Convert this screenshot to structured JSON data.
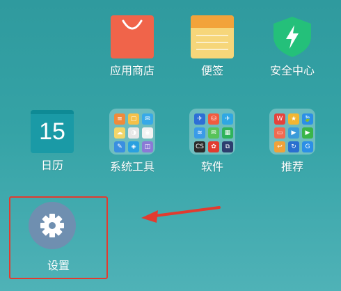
{
  "apps": {
    "app_store": {
      "label": "应用商店"
    },
    "notes": {
      "label": "便签"
    },
    "security": {
      "label": "安全中心"
    },
    "calendar": {
      "label": "日历",
      "day": "15"
    },
    "system_tools": {
      "label": "系统工具"
    },
    "software": {
      "label": "软件"
    },
    "recommend": {
      "label": "推荐"
    },
    "settings": {
      "label": "设置"
    }
  },
  "folder_icons": {
    "system_tools": [
      "#f08a3a",
      "#f4c14a",
      "#37a9e8",
      "#f2d66a",
      "#e6e6e6",
      "#f2f2f2",
      "#3a8fe0",
      "#2aa0e0",
      "#8a7ad6"
    ],
    "software": [
      "#2d6fd6",
      "#f15b3f",
      "#2fa7e3",
      "#3a9be8",
      "#58c35a",
      "#2fb35b",
      "#2b2b2b",
      "#e23b2f",
      "#2c3e6e"
    ],
    "recommend": [
      "#e5423b",
      "#f2b631",
      "#2c8fe6",
      "#f26a50",
      "#3a9ad9",
      "#3ab54a",
      "#f0a23a",
      "#2a6fd0",
      "#2c8fe6"
    ]
  },
  "folder_glyphs": {
    "system_tools": [
      "≡",
      "▢",
      "✉",
      "☁",
      "◑",
      "◉",
      "✎",
      "◈",
      "◫"
    ],
    "software": [
      "✈",
      "⛁",
      "✈",
      "≋",
      "✉",
      "▦",
      "CS",
      "✿",
      "⧉"
    ],
    "recommend": [
      "W",
      "★",
      "🍃",
      "▭",
      "▶",
      "▶",
      "↩",
      "↻",
      "G"
    ]
  },
  "colors": {
    "highlight": "#e23b2f",
    "arrow": "#e23b2f"
  }
}
